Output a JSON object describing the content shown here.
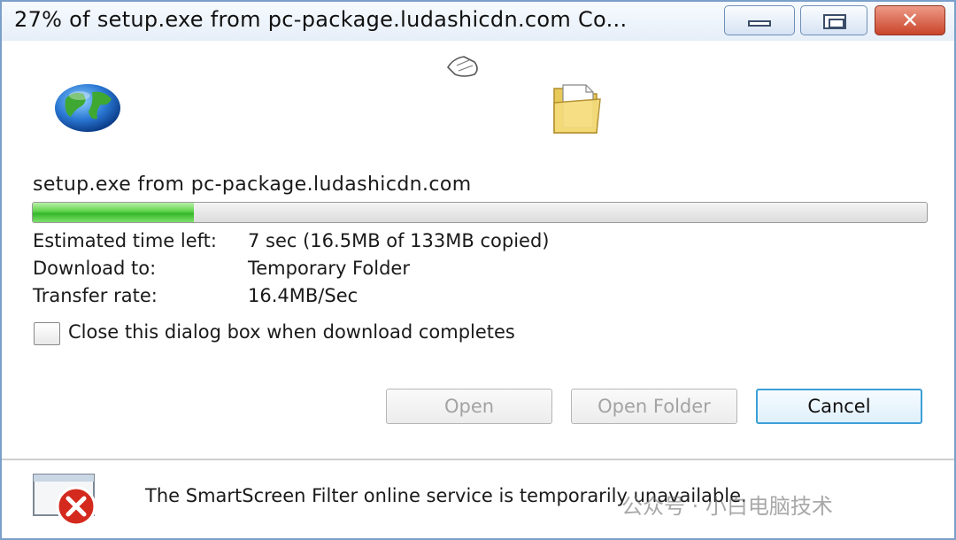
{
  "window": {
    "title": "27% of setup.exe from pc-package.ludashicdn.com Co...",
    "close_glyph": "✕"
  },
  "animation": {
    "icons": [
      "globe-icon",
      "flying-document-icon",
      "folder-icon"
    ]
  },
  "download": {
    "source": "setup.exe from pc-package.ludashicdn.com",
    "progress_fraction": 0.18,
    "rows": [
      {
        "label": "Estimated time left:",
        "value": "7 sec (16.5MB of 133MB copied)"
      },
      {
        "label": "Download to:",
        "value": "Temporary Folder"
      },
      {
        "label": "Transfer rate:",
        "value": "16.4MB/Sec"
      }
    ],
    "close_when_done": {
      "label": "Close this dialog box when download completes",
      "checked": false
    }
  },
  "buttons": {
    "open": "Open",
    "open_folder": "Open Folder",
    "cancel": "Cancel"
  },
  "status": {
    "message": "The SmartScreen Filter online service is temporarily unavailable.",
    "icon": "error-icon"
  },
  "watermark": {
    "text": "公众号 · 小白电脑技术"
  },
  "colors": {
    "progress": "#35b62a",
    "error": "#d42a1e",
    "accent_button_border": "#3c9fd8"
  }
}
